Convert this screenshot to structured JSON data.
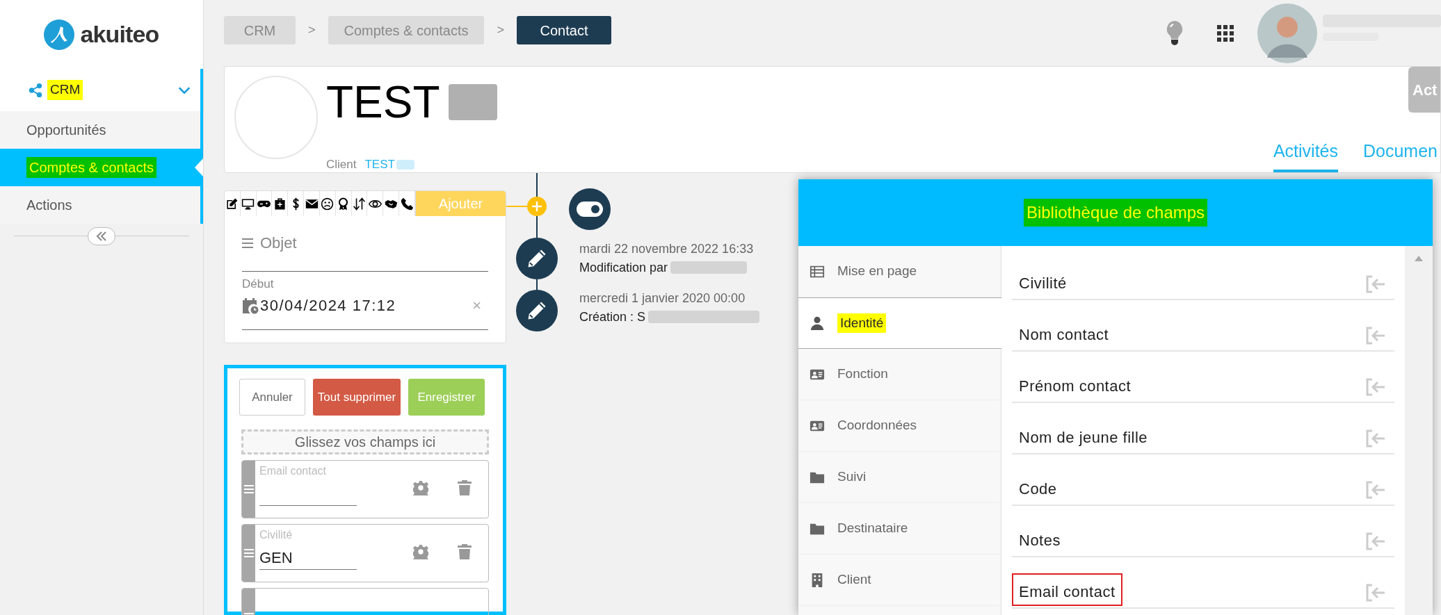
{
  "logo": {
    "text": "akuiteo"
  },
  "sidebar": {
    "section": {
      "label": "CRM",
      "expanded": true,
      "color": "#ffff00"
    },
    "items": [
      {
        "label": "Opportunités",
        "selected": false
      },
      {
        "label": "Comptes & contacts",
        "selected": true,
        "color": "#00c000"
      },
      {
        "label": "Actions",
        "selected": false
      }
    ]
  },
  "breadcrumb": [
    {
      "kind": "crumb",
      "label": "CRM",
      "current": false
    },
    {
      "kind": "separator",
      "label": ">"
    },
    {
      "kind": "crumb",
      "label": "Comptes & contacts",
      "current": false
    },
    {
      "kind": "separator",
      "label": ">"
    },
    {
      "kind": "crumb",
      "label": "Contact",
      "current": true
    }
  ],
  "contact": {
    "name": "TEST",
    "client_label": "Client",
    "client_link": "TEST",
    "action_button": "Act",
    "tabs": [
      {
        "label": "Activités",
        "selected": true
      },
      {
        "label": "Documen",
        "selected": false
      }
    ]
  },
  "activity_form": {
    "add_button": "Ajouter",
    "subject_placeholder": "Objet",
    "start_label": "Début",
    "start_value": "30/04/2024 17:12",
    "clear": "×"
  },
  "timeline": [
    {
      "date": "mardi 22 novembre 2022 16:33",
      "text": "Modification par"
    },
    {
      "date": "mercredi 1 janvier 2020 00:00",
      "text": "Création : S"
    }
  ],
  "builder": {
    "buttons": [
      {
        "label": "Annuler",
        "kind": "cancel"
      },
      {
        "label": "Tout supprimer",
        "kind": "danger"
      },
      {
        "label": "Enregistrer",
        "kind": "save"
      }
    ],
    "dropzone": "Glissez vos champs ici",
    "fields": [
      {
        "label": "Email contact"
      },
      {
        "label": "Civilité",
        "value": "GEN"
      }
    ]
  },
  "library": {
    "title": {
      "text": "Bibliothèque de champs",
      "color": "#00c000"
    },
    "categories": [
      {
        "label": "Mise en page",
        "selected": false
      },
      {
        "label": "Identité",
        "selected": true,
        "color": "#ffff00"
      },
      {
        "label": "Fonction",
        "selected": false
      },
      {
        "label": "Coordonnées",
        "selected": false
      },
      {
        "label": "Suivi",
        "selected": false
      },
      {
        "label": "Destinataire",
        "selected": false
      },
      {
        "label": "Client",
        "selected": false
      }
    ],
    "fields": [
      {
        "label": "Civilité",
        "outlined": false
      },
      {
        "label": "Nom contact",
        "outlined": false
      },
      {
        "label": "Prénom contact",
        "outlined": false
      },
      {
        "label": "Nom de jeune fille",
        "outlined": false
      },
      {
        "label": "Code",
        "outlined": false
      },
      {
        "label": "Notes",
        "outlined": false
      },
      {
        "label": "Email contact",
        "outlined": true
      }
    ]
  }
}
